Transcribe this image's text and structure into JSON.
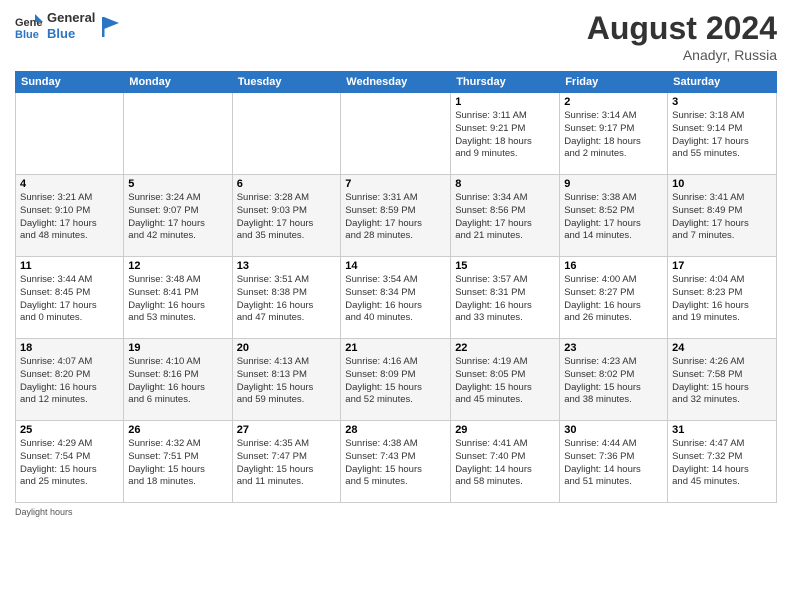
{
  "header": {
    "logo_line1": "General",
    "logo_line2": "Blue",
    "month_title": "August 2024",
    "subtitle": "Anadyr, Russia"
  },
  "weekdays": [
    "Sunday",
    "Monday",
    "Tuesday",
    "Wednesday",
    "Thursday",
    "Friday",
    "Saturday"
  ],
  "weeks": [
    [
      {
        "day": "",
        "info": ""
      },
      {
        "day": "",
        "info": ""
      },
      {
        "day": "",
        "info": ""
      },
      {
        "day": "",
        "info": ""
      },
      {
        "day": "1",
        "info": "Sunrise: 3:11 AM\nSunset: 9:21 PM\nDaylight: 18 hours\nand 9 minutes."
      },
      {
        "day": "2",
        "info": "Sunrise: 3:14 AM\nSunset: 9:17 PM\nDaylight: 18 hours\nand 2 minutes."
      },
      {
        "day": "3",
        "info": "Sunrise: 3:18 AM\nSunset: 9:14 PM\nDaylight: 17 hours\nand 55 minutes."
      }
    ],
    [
      {
        "day": "4",
        "info": "Sunrise: 3:21 AM\nSunset: 9:10 PM\nDaylight: 17 hours\nand 48 minutes."
      },
      {
        "day": "5",
        "info": "Sunrise: 3:24 AM\nSunset: 9:07 PM\nDaylight: 17 hours\nand 42 minutes."
      },
      {
        "day": "6",
        "info": "Sunrise: 3:28 AM\nSunset: 9:03 PM\nDaylight: 17 hours\nand 35 minutes."
      },
      {
        "day": "7",
        "info": "Sunrise: 3:31 AM\nSunset: 8:59 PM\nDaylight: 17 hours\nand 28 minutes."
      },
      {
        "day": "8",
        "info": "Sunrise: 3:34 AM\nSunset: 8:56 PM\nDaylight: 17 hours\nand 21 minutes."
      },
      {
        "day": "9",
        "info": "Sunrise: 3:38 AM\nSunset: 8:52 PM\nDaylight: 17 hours\nand 14 minutes."
      },
      {
        "day": "10",
        "info": "Sunrise: 3:41 AM\nSunset: 8:49 PM\nDaylight: 17 hours\nand 7 minutes."
      }
    ],
    [
      {
        "day": "11",
        "info": "Sunrise: 3:44 AM\nSunset: 8:45 PM\nDaylight: 17 hours\nand 0 minutes."
      },
      {
        "day": "12",
        "info": "Sunrise: 3:48 AM\nSunset: 8:41 PM\nDaylight: 16 hours\nand 53 minutes."
      },
      {
        "day": "13",
        "info": "Sunrise: 3:51 AM\nSunset: 8:38 PM\nDaylight: 16 hours\nand 47 minutes."
      },
      {
        "day": "14",
        "info": "Sunrise: 3:54 AM\nSunset: 8:34 PM\nDaylight: 16 hours\nand 40 minutes."
      },
      {
        "day": "15",
        "info": "Sunrise: 3:57 AM\nSunset: 8:31 PM\nDaylight: 16 hours\nand 33 minutes."
      },
      {
        "day": "16",
        "info": "Sunrise: 4:00 AM\nSunset: 8:27 PM\nDaylight: 16 hours\nand 26 minutes."
      },
      {
        "day": "17",
        "info": "Sunrise: 4:04 AM\nSunset: 8:23 PM\nDaylight: 16 hours\nand 19 minutes."
      }
    ],
    [
      {
        "day": "18",
        "info": "Sunrise: 4:07 AM\nSunset: 8:20 PM\nDaylight: 16 hours\nand 12 minutes."
      },
      {
        "day": "19",
        "info": "Sunrise: 4:10 AM\nSunset: 8:16 PM\nDaylight: 16 hours\nand 6 minutes."
      },
      {
        "day": "20",
        "info": "Sunrise: 4:13 AM\nSunset: 8:13 PM\nDaylight: 15 hours\nand 59 minutes."
      },
      {
        "day": "21",
        "info": "Sunrise: 4:16 AM\nSunset: 8:09 PM\nDaylight: 15 hours\nand 52 minutes."
      },
      {
        "day": "22",
        "info": "Sunrise: 4:19 AM\nSunset: 8:05 PM\nDaylight: 15 hours\nand 45 minutes."
      },
      {
        "day": "23",
        "info": "Sunrise: 4:23 AM\nSunset: 8:02 PM\nDaylight: 15 hours\nand 38 minutes."
      },
      {
        "day": "24",
        "info": "Sunrise: 4:26 AM\nSunset: 7:58 PM\nDaylight: 15 hours\nand 32 minutes."
      }
    ],
    [
      {
        "day": "25",
        "info": "Sunrise: 4:29 AM\nSunset: 7:54 PM\nDaylight: 15 hours\nand 25 minutes."
      },
      {
        "day": "26",
        "info": "Sunrise: 4:32 AM\nSunset: 7:51 PM\nDaylight: 15 hours\nand 18 minutes."
      },
      {
        "day": "27",
        "info": "Sunrise: 4:35 AM\nSunset: 7:47 PM\nDaylight: 15 hours\nand 11 minutes."
      },
      {
        "day": "28",
        "info": "Sunrise: 4:38 AM\nSunset: 7:43 PM\nDaylight: 15 hours\nand 5 minutes."
      },
      {
        "day": "29",
        "info": "Sunrise: 4:41 AM\nSunset: 7:40 PM\nDaylight: 14 hours\nand 58 minutes."
      },
      {
        "day": "30",
        "info": "Sunrise: 4:44 AM\nSunset: 7:36 PM\nDaylight: 14 hours\nand 51 minutes."
      },
      {
        "day": "31",
        "info": "Sunrise: 4:47 AM\nSunset: 7:32 PM\nDaylight: 14 hours\nand 45 minutes."
      }
    ]
  ],
  "footer": {
    "daylight_label": "Daylight hours"
  }
}
